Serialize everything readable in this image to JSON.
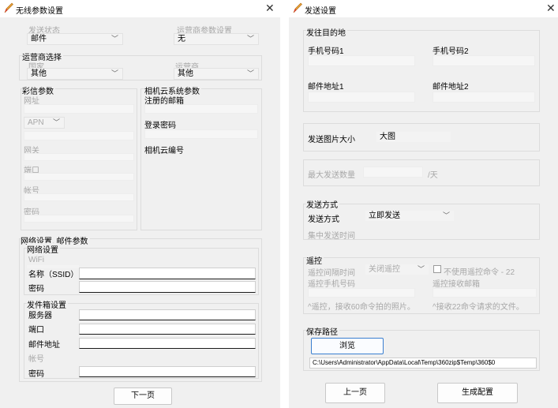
{
  "left_dialog": {
    "title": "无线参数设置",
    "send_status": {
      "label": "发送状态",
      "value": "邮件"
    },
    "carrier_params": {
      "label": "运营商参数设置",
      "value": "无"
    },
    "carrier_select": {
      "title": "运营商选择",
      "country_label": "国家",
      "country_value": "其他",
      "carrier_label": "运营商",
      "carrier_value": "其他"
    },
    "mms": {
      "title": "彩信参数",
      "url_label": "网址",
      "apn_value": "APN",
      "gateway_label": "网关",
      "port_label": "端口",
      "account_label": "帐号",
      "password_label": "密码"
    },
    "cloud": {
      "title": "相机云系统参数",
      "registered_email_label": "注册的邮箱",
      "login_password_label": "登录密码",
      "camera_cloud_id_label": "相机云编号"
    },
    "network": {
      "title": "网络设置, 邮件参数",
      "sub_title": "网络设置",
      "wifi_label": "WiFi",
      "ssid_label": "名称（SSID）",
      "password_label": "密码"
    },
    "outbox": {
      "title": "发件箱设置",
      "server_label": "服务器",
      "port_label": "端口",
      "email_label": "邮件地址",
      "account_label": "帐号",
      "password_label": "密码"
    },
    "next_button": "下一页"
  },
  "right_dialog": {
    "title": "发送设置",
    "destination": {
      "title": "发往目的地",
      "phone1_label": "手机号码1",
      "phone2_label": "手机号码2",
      "email1_label": "邮件地址1",
      "email2_label": "邮件地址2"
    },
    "image_size": {
      "label": "发送图片大小",
      "value": "大图"
    },
    "max_send": {
      "label": "最大发送数量",
      "unit": "/天"
    },
    "send_mode": {
      "title": "发送方式",
      "label": "发送方式",
      "value": "立即发送",
      "batch_time_label": "集中发送时间"
    },
    "remote": {
      "title": "遥控",
      "interval_label": "遥控间隔时间",
      "interval_value": "关闭遥控",
      "disable_checkbox_label": "不使用遥控命令 - 22",
      "phone_label": "遥控手机号码",
      "email_label": "遥控接收邮箱",
      "hint_left": "^遥控，接收60命令拍的照片。",
      "hint_right": "^接收22命令请求的文件。"
    },
    "save_path": {
      "title": "保存路径",
      "browse_button": "浏览",
      "path_value": "C:\\Users\\Administrator\\AppData\\Local\\Temp\\360zip$Temp\\360$0"
    },
    "prev_button": "上一页",
    "generate_button": "生成配置"
  }
}
